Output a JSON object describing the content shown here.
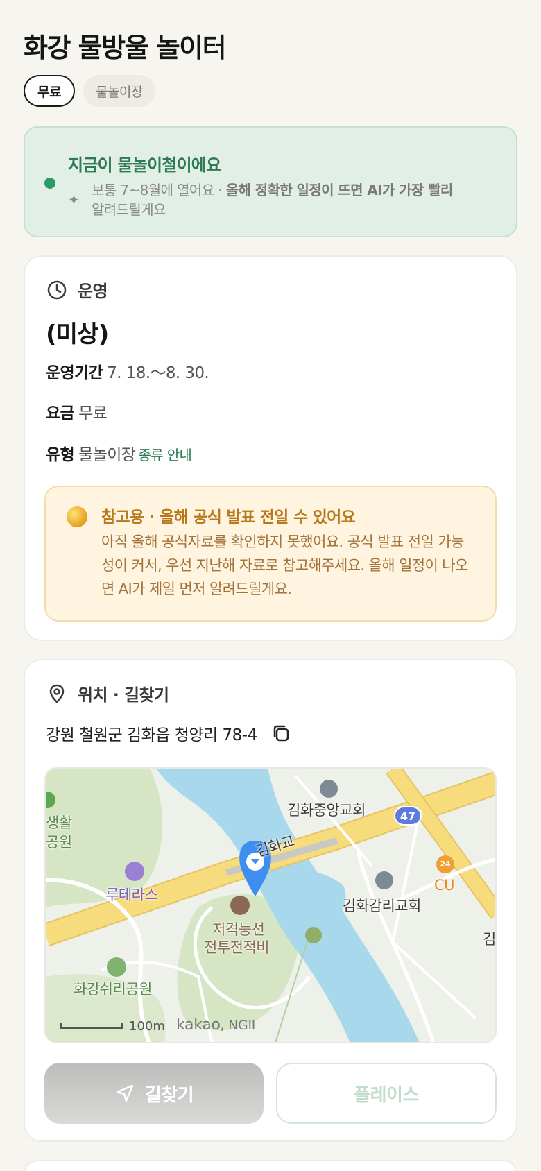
{
  "header": {
    "title": "화강 물방울 놀이터",
    "tags": [
      "무료",
      "물놀이장"
    ]
  },
  "season": {
    "title": "지금이 물놀이철이에요",
    "sub_plain": "보통 7~8월에 열어요 · ",
    "sub_bold": "올해 정확한 일정이 뜨면 AI가 가장 빨리",
    "sub_tail": "알려드릴게요"
  },
  "operation": {
    "heading": "운영",
    "status": "(미상)",
    "period_label": "운영기간",
    "period_value": "7. 18.～8. 30.",
    "fee_label": "요금",
    "fee_value": "무료",
    "type_label": "유형",
    "type_value": "물놀이장",
    "type_link": "종류 안내",
    "notice_title": "참고용 · 올해 공식 발표 전일 수 있어요",
    "notice_body": "아직 올해 공식자료를 확인하지 못했어요. 공식 발표 전일 가능성이 커서, 우선 지난해 자료로 참고해주세요. 올해 일정이 나오면 AI가 제일 먼저 알려드릴게요."
  },
  "location": {
    "heading": "위치 · 길찾기",
    "address": "강원 철원군 김화읍 청양리 78-4",
    "map": {
      "labels": {
        "church_central": "김화중앙교회",
        "bridge": "김화교",
        "park_left_1": "생활",
        "park_left_2": "공원",
        "lodging": "루테라스",
        "church_gamri": "김화감리교회",
        "cu": "CU",
        "monument_1": "저격능선",
        "monument_2": "전투전적비",
        "rest_park": "화강쉬리공원",
        "edge_text": "김",
        "road_number": "47",
        "store_hours": "24",
        "scale": "100m",
        "copyright_main": "kakao",
        "copyright_sub": ", NGII"
      },
      "colors": {
        "water": "#a8d8ec",
        "road_main": "#f7dc7e",
        "park": "#d6e6c4",
        "base": "#eef0ea",
        "pin": "#3d8ef0"
      }
    },
    "buttons": {
      "route": "길찾기",
      "place": "플레이스"
    }
  }
}
